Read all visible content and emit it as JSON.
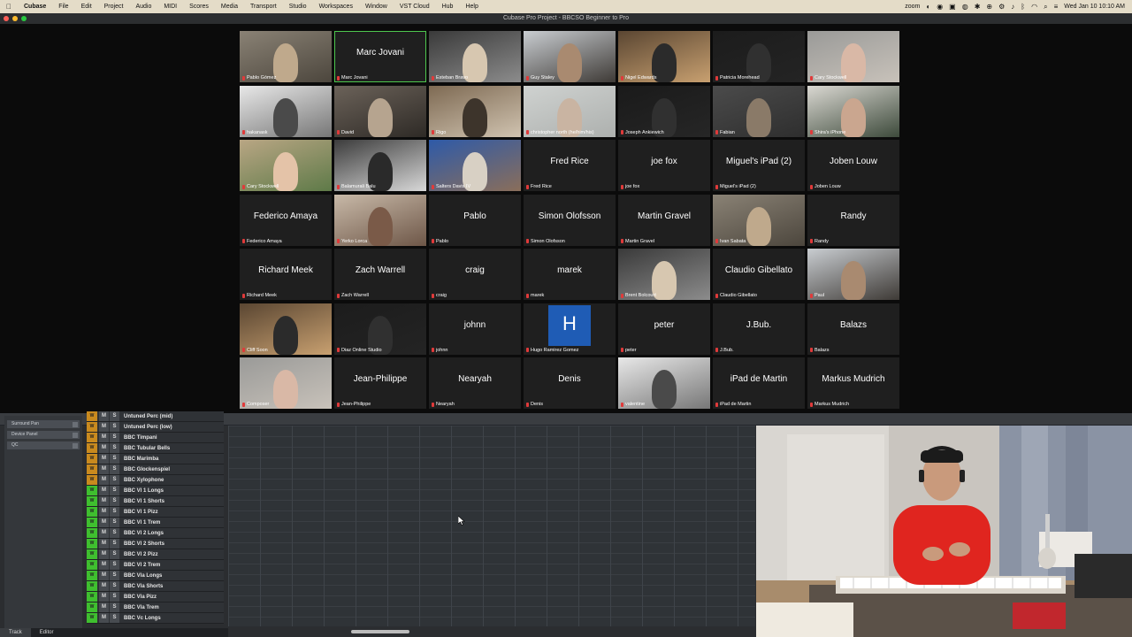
{
  "menubar": {
    "apple": "",
    "app_name": "Cubase",
    "items": [
      "File",
      "Edit",
      "Project",
      "Audio",
      "MIDI",
      "Scores",
      "Media",
      "Transport",
      "Studio",
      "Workspaces",
      "Window",
      "VST Cloud",
      "Hub",
      "Help"
    ],
    "zoom_label": "zoom",
    "datetime": "Wed Jan 10  10:10 AM"
  },
  "window": {
    "title": "Cubase Pro Project - BBCSO Beginner to Pro"
  },
  "participants": [
    {
      "name": "Pablo Gómez",
      "big": "",
      "video": true
    },
    {
      "name": "Marc Jovani",
      "big": "Marc Jovani",
      "video": false,
      "active": true
    },
    {
      "name": "Esteban Bravo",
      "big": "",
      "video": true
    },
    {
      "name": "Guy Staley",
      "big": "",
      "video": true
    },
    {
      "name": "Nigel Edwards",
      "big": "",
      "video": true
    },
    {
      "name": "Patricia Morehead",
      "big": "",
      "video": true
    },
    {
      "name": "Cary Stockwell",
      "big": "",
      "video": true
    },
    {
      "name": "hakanask",
      "big": "",
      "video": true
    },
    {
      "name": "David",
      "big": "",
      "video": true
    },
    {
      "name": "Rigo",
      "big": "",
      "video": true
    },
    {
      "name": "christopher north (he/him/his)",
      "big": "",
      "video": true
    },
    {
      "name": "Joseph Ankiewich",
      "big": "",
      "video": true
    },
    {
      "name": "Fabian",
      "big": "",
      "video": true
    },
    {
      "name": "Shira's iPhone",
      "big": "",
      "video": true
    },
    {
      "name": "Cary Stockwell",
      "big": "",
      "video": true
    },
    {
      "name": "Balamurali Balu",
      "big": "",
      "video": true
    },
    {
      "name": "Salters Davis IV",
      "big": "",
      "video": true
    },
    {
      "name": "Fred Rice",
      "big": "Fred Rice",
      "video": false
    },
    {
      "name": "joe fox",
      "big": "joe fox",
      "video": false
    },
    {
      "name": "Miguel's iPad (2)",
      "big": "Miguel's iPad (2)",
      "video": false
    },
    {
      "name": "Joben Louw",
      "big": "Joben Louw",
      "video": false
    },
    {
      "name": "Federico Amaya",
      "big": "Federico Amaya",
      "video": false
    },
    {
      "name": "Yerko Lorca",
      "big": "",
      "video": true
    },
    {
      "name": "Pablo",
      "big": "Pablo",
      "video": false
    },
    {
      "name": "Simon Olofsson",
      "big": "Simon Olofsson",
      "video": false
    },
    {
      "name": "Martin Gravel",
      "big": "Martin Gravel",
      "video": false
    },
    {
      "name": "Ivan Sabata",
      "big": "",
      "video": true
    },
    {
      "name": "Randy",
      "big": "Randy",
      "video": false
    },
    {
      "name": "Richard Meek",
      "big": "Richard Meek",
      "video": false
    },
    {
      "name": "Zach Warrell",
      "big": "Zach Warrell",
      "video": false
    },
    {
      "name": "craig",
      "big": "craig",
      "video": false
    },
    {
      "name": "marek",
      "big": "marek",
      "video": false
    },
    {
      "name": "Brent Bolcourt",
      "big": "",
      "video": true
    },
    {
      "name": "Claudio Gibellato",
      "big": "Claudio Gibellato",
      "video": false
    },
    {
      "name": "Paul",
      "big": "",
      "video": true
    },
    {
      "name": "Cliff Soon",
      "big": "",
      "video": true
    },
    {
      "name": "Diaz Online Studio",
      "big": "",
      "video": true
    },
    {
      "name": "johnn",
      "big": "johnn",
      "video": false
    },
    {
      "name": "Hugo Ramirez Gomez",
      "big": "H",
      "video": false,
      "avatar": true
    },
    {
      "name": "peter",
      "big": "peter",
      "video": false
    },
    {
      "name": "J.Bub.",
      "big": "J.Bub.",
      "video": false
    },
    {
      "name": "Balazs",
      "big": "Balazs",
      "video": false
    },
    {
      "name": "Composer",
      "big": "",
      "video": true
    },
    {
      "name": "Jean-Philippe",
      "big": "Jean-Philippe",
      "video": false
    },
    {
      "name": "Nearyah",
      "big": "Nearyah",
      "video": false
    },
    {
      "name": "Denis",
      "big": "Denis",
      "video": false
    },
    {
      "name": "valentine",
      "big": "",
      "video": true
    },
    {
      "name": "iPad de Martin",
      "big": "iPad de Martin",
      "video": false
    },
    {
      "name": "Markus Mudrich",
      "big": "Markus Mudrich",
      "video": false
    }
  ],
  "inspector": {
    "items": [
      "Surround Pan",
      "Device Panel",
      "QC"
    ]
  },
  "tracks": [
    {
      "name": "Untuned Perc (mid)",
      "color": "#c98a1e"
    },
    {
      "name": "Untuned Perc (low)",
      "color": "#c98a1e"
    },
    {
      "name": "BBC Timpani",
      "color": "#c98a1e"
    },
    {
      "name": "BBC Tubular Bells",
      "color": "#c98a1e"
    },
    {
      "name": "BBC Marimba",
      "color": "#c98a1e"
    },
    {
      "name": "BBC Glockenspiel",
      "color": "#c98a1e"
    },
    {
      "name": "BBC Xylophone",
      "color": "#c98a1e"
    },
    {
      "name": "BBC Vl 1 Longs",
      "color": "#3fbf2f"
    },
    {
      "name": "BBC Vl 1 Shorts",
      "color": "#3fbf2f"
    },
    {
      "name": "BBC Vl 1 Pizz",
      "color": "#3fbf2f"
    },
    {
      "name": "BBC Vl 1 Trem",
      "color": "#3fbf2f"
    },
    {
      "name": "BBC Vl 2 Longs",
      "color": "#3fbf2f"
    },
    {
      "name": "BBC Vl 2 Shorts",
      "color": "#3fbf2f"
    },
    {
      "name": "BBC Vl 2 Pizz",
      "color": "#3fbf2f"
    },
    {
      "name": "BBC Vl 2 Trem",
      "color": "#3fbf2f"
    },
    {
      "name": "BBC Vla Longs",
      "color": "#3fbf2f"
    },
    {
      "name": "BBC Vla Shorts",
      "color": "#3fbf2f"
    },
    {
      "name": "BBC Vla Pizz",
      "color": "#3fbf2f"
    },
    {
      "name": "BBC Vla Trem",
      "color": "#3fbf2f"
    },
    {
      "name": "BBC Vc Longs",
      "color": "#3fbf2f"
    }
  ],
  "track_buttons": {
    "mute": "M",
    "solo": "S",
    "icon": "W"
  },
  "bottom_tabs": [
    "Track",
    "Editor"
  ]
}
